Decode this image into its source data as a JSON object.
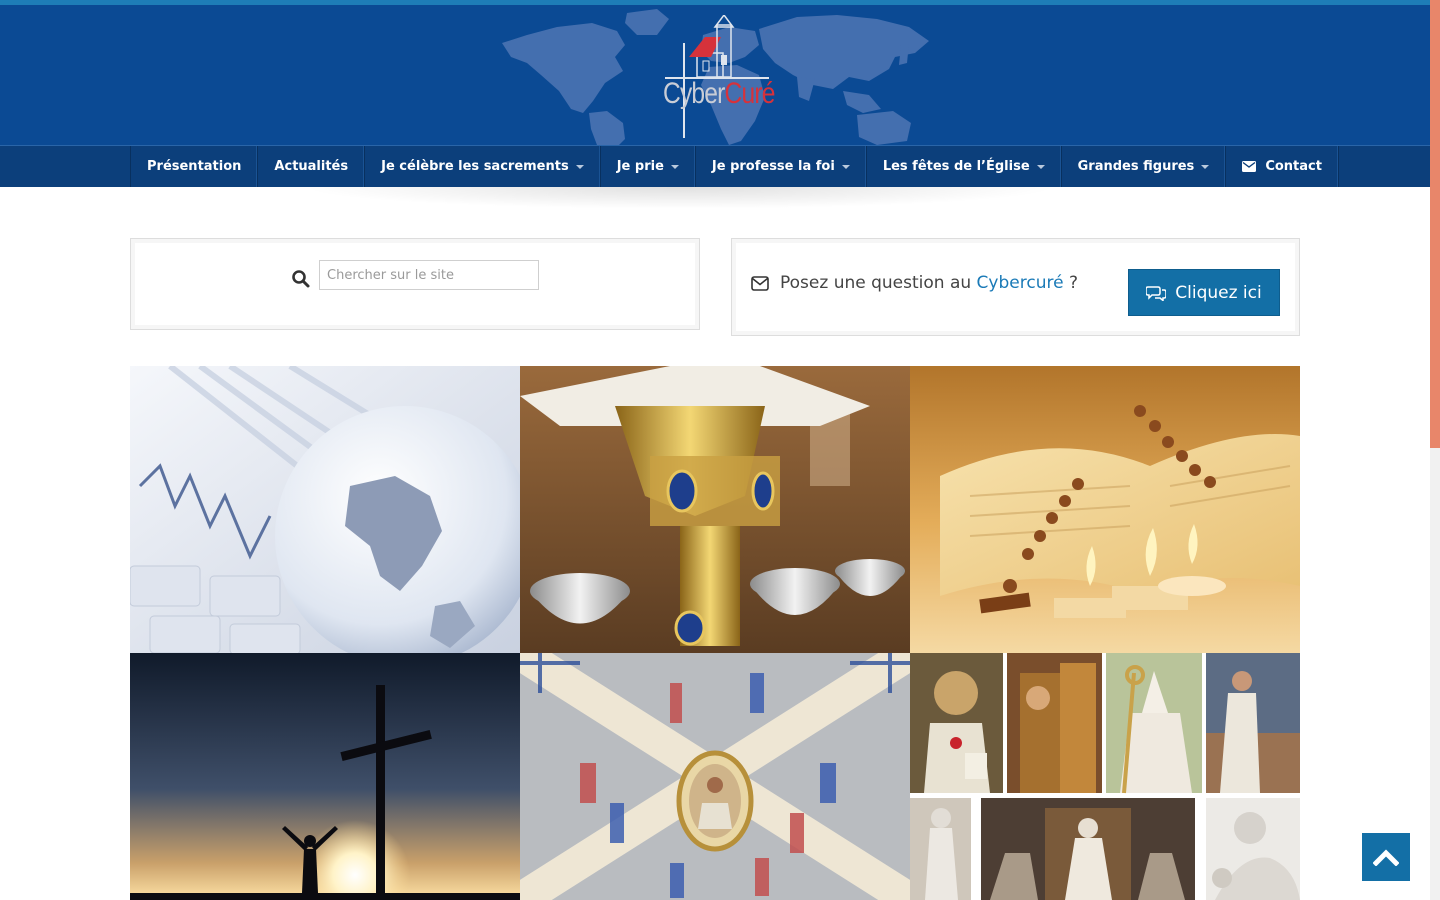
{
  "site": {
    "logo_part1": "Cyber",
    "logo_part2": "Curé"
  },
  "nav": {
    "items": [
      {
        "label": "Présentation",
        "dropdown": false
      },
      {
        "label": "Actualités",
        "dropdown": false
      },
      {
        "label": "Je célèbre les sacrements",
        "dropdown": true
      },
      {
        "label": "Je prie",
        "dropdown": true
      },
      {
        "label": "Je professe la foi",
        "dropdown": true
      },
      {
        "label": "Les fêtes de l’Église",
        "dropdown": true
      },
      {
        "label": "Grandes figures",
        "dropdown": true
      },
      {
        "label": "Contact",
        "dropdown": false,
        "icon": "envelope-icon"
      }
    ]
  },
  "search": {
    "placeholder": "Chercher sur le site",
    "icon": "search-icon"
  },
  "question": {
    "text_before": "Posez une question au ",
    "link_text": "Cybercuré",
    "text_after": " ?",
    "button_label": "Cliquez ici",
    "icon": "envelope-outline-icon",
    "button_icon": "chat-bubbles-icon"
  },
  "tiles": [
    {
      "name": "tile-actualites",
      "subject": "globe-and-newspaper"
    },
    {
      "name": "tile-sacrements",
      "subject": "chalice-and-ciboria"
    },
    {
      "name": "tile-priere",
      "subject": "bible-rosary-candles"
    },
    {
      "name": "tile-foi",
      "subject": "cross-silhouette-sunset"
    },
    {
      "name": "tile-fetes",
      "subject": "painted-ceiling-fresco"
    },
    {
      "name": "tile-grandes-figures",
      "subject": "saints-collage"
    }
  ],
  "colors": {
    "header_bg": "#0b4a94",
    "nav_bg": "#0c3f7b",
    "accent": "#136fa6",
    "link": "#1a7ab7",
    "logo_red": "#d6323b"
  },
  "scroll_top": {
    "icon": "chevron-up-icon"
  }
}
